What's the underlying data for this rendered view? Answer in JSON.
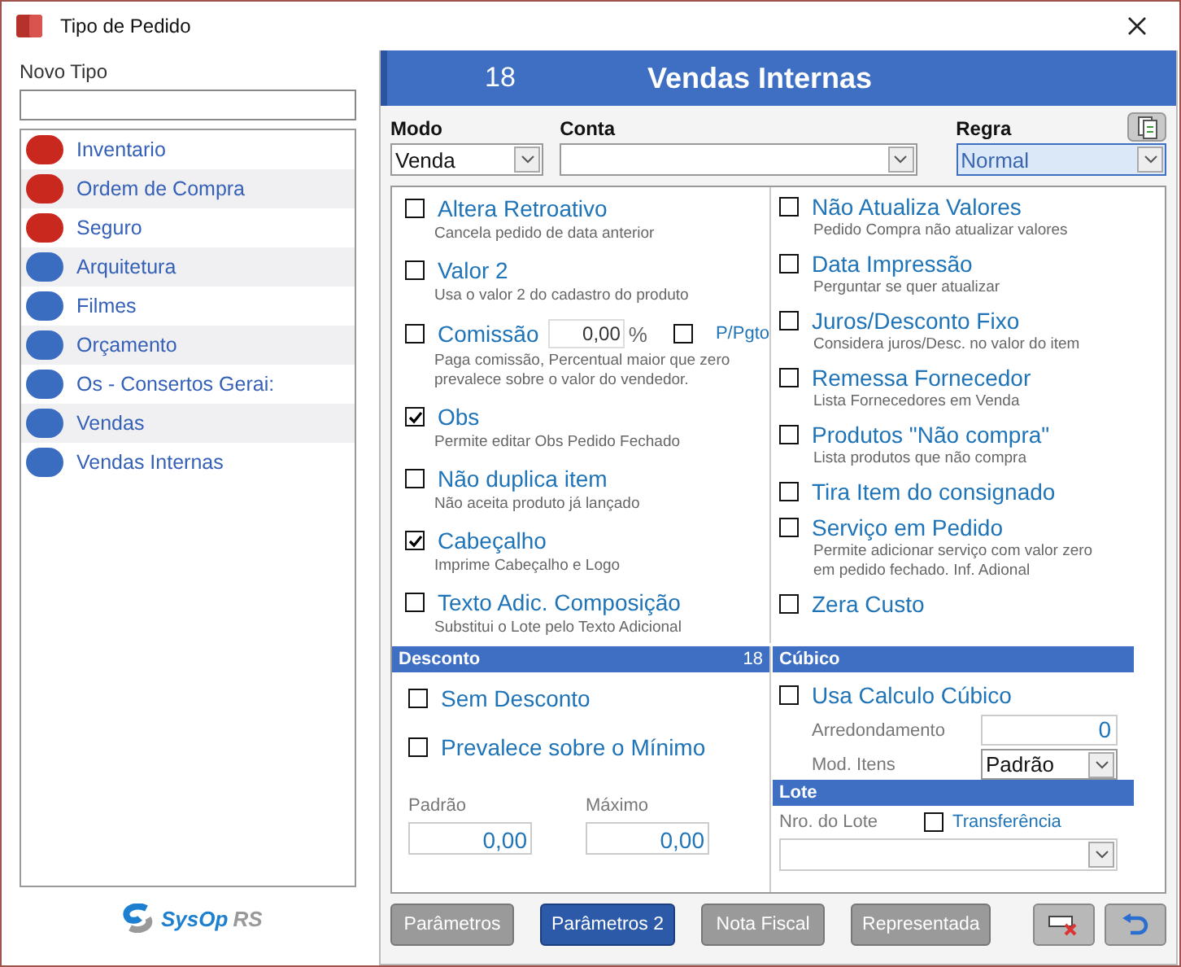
{
  "window": {
    "title": "Tipo de Pedido"
  },
  "sidebar": {
    "new_type_label": "Novo Tipo",
    "logo": {
      "name": "SysOp",
      "suffix": "RS"
    },
    "items": [
      {
        "label": "Inventario",
        "color": "#c8281e"
      },
      {
        "label": "Ordem de Compra",
        "color": "#c8281e"
      },
      {
        "label": "Seguro",
        "color": "#c8281e"
      },
      {
        "label": "Arquitetura",
        "color": "#3a6cc0"
      },
      {
        "label": "Filmes",
        "color": "#3a6cc0"
      },
      {
        "label": "Orçamento",
        "color": "#3a6cc0"
      },
      {
        "label": "Os - Consertos Gerai:",
        "color": "#3a6cc0"
      },
      {
        "label": "Vendas",
        "color": "#3a6cc0"
      },
      {
        "label": "Vendas Internas",
        "color": "#3a6cc0"
      }
    ]
  },
  "header": {
    "number": "18",
    "title": "Vendas Internas"
  },
  "fields": {
    "modo": {
      "label": "Modo",
      "value": "Venda"
    },
    "conta": {
      "label": "Conta"
    },
    "regra": {
      "label": "Regra",
      "value": "Normal"
    }
  },
  "options_left": [
    {
      "kind": "check",
      "label": "Altera Retroativo",
      "hint": "Cancela pedido de data anterior",
      "checked": false
    },
    {
      "kind": "check",
      "label": "Valor 2",
      "hint": "Usa o valor 2 do cadastro do produto",
      "checked": false
    },
    {
      "kind": "value",
      "label": "Comissão",
      "value": "0,00",
      "unit": "%",
      "extra_label": "P/Pgto",
      "extra_checked": false,
      "hint": "Paga comissão, Percentual maior que zero prevalece sobre o valor do vendedor.",
      "checked": false
    },
    {
      "kind": "check",
      "label": "Obs",
      "hint": "Permite editar Obs Pedido Fechado",
      "checked": true
    },
    {
      "kind": "check",
      "label": "Não duplica item",
      "hint": "Não aceita produto já lançado",
      "checked": false
    },
    {
      "kind": "check",
      "label": "Cabeçalho",
      "hint": "Imprime Cabeçalho e Logo",
      "checked": true
    },
    {
      "kind": "check",
      "label": "Texto Adic. Composição",
      "hint": "Substitui o Lote pelo Texto Adicional",
      "checked": false
    }
  ],
  "options_right": [
    {
      "kind": "check",
      "label": "Não Atualiza Valores",
      "hint": "Pedido Compra não atualizar valores",
      "checked": false
    },
    {
      "kind": "check",
      "label": "Data Impressão",
      "hint": "Perguntar se quer atualizar",
      "checked": false
    },
    {
      "kind": "check",
      "label": "Juros/Desconto Fixo",
      "hint": "Considera juros/Desc. no valor do item",
      "checked": false
    },
    {
      "kind": "check",
      "label": "Remessa Fornecedor",
      "hint": "Lista Fornecedores em Venda",
      "checked": false
    },
    {
      "kind": "check",
      "label": "Produtos \"Não compra\"",
      "hint": "Lista produtos que não compra",
      "checked": false
    },
    {
      "kind": "check",
      "label": "Tira Item do consignado",
      "checked": false
    },
    {
      "kind": "check",
      "label": "Serviço em Pedido",
      "hint": "Permite adicionar serviço com valor zero em pedido fechado. Inf. Adional",
      "checked": false
    },
    {
      "kind": "check",
      "label": "Zera Custo",
      "checked": false
    }
  ],
  "desconto": {
    "title": "Desconto",
    "count": "18",
    "options": [
      {
        "label": "Sem Desconto",
        "checked": false
      },
      {
        "label": "Prevalece sobre o Mínimo",
        "checked": false
      }
    ],
    "padrao": {
      "label": "Padrão",
      "value": "0,00"
    },
    "maximo": {
      "label": "Máximo",
      "value": "0,00"
    }
  },
  "cubico": {
    "title": "Cúbico",
    "option": {
      "label": "Usa Calculo Cúbico",
      "checked": false
    },
    "arredondamento": {
      "label": "Arredondamento",
      "value": "0"
    },
    "mod_itens": {
      "label": "Mod. Itens",
      "value": "Padrão"
    }
  },
  "lote": {
    "title": "Lote",
    "nro_label": "Nro. do Lote",
    "transfer": {
      "label": "Transferência",
      "checked": false
    }
  },
  "tabs": [
    {
      "label": "Parâmetros",
      "selected": false
    },
    {
      "label": "Parâmetros 2",
      "selected": true
    },
    {
      "label": "Nota Fiscal",
      "selected": false
    },
    {
      "label": "Representada",
      "selected": false
    }
  ]
}
